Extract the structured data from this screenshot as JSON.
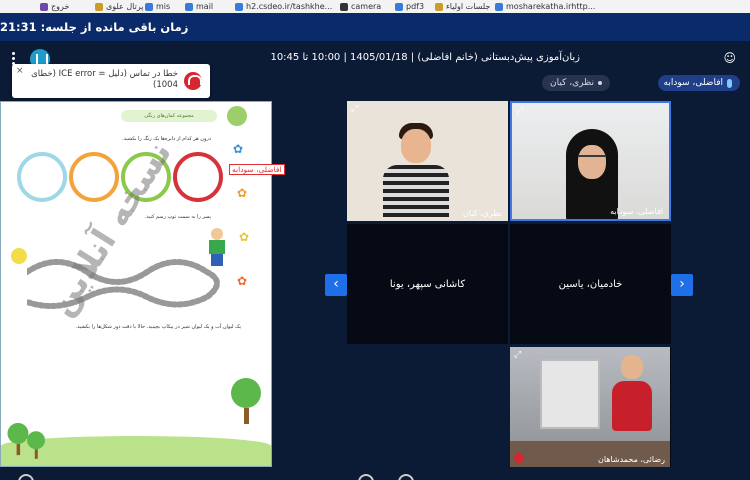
{
  "bookmarks": [
    "خروج",
    "پرتال علوی",
    "mis",
    "mail",
    "h2.csdeo.ir/tashkhe...",
    "camera",
    "pdf3",
    "جلسات اولیاء",
    "mosharekatha.irhttp..."
  ],
  "timer": {
    "label": "زمان باقی مانده از جلسه: 21:31"
  },
  "header": {
    "session_title": "زبان‌آموزی پیش‌دبستانی (خانم افاضلی) | 1405/01/18 | 10:00 تا 10:45"
  },
  "speakers": {
    "speaking": "افاضلی، سودابه",
    "other": "نظری، کیان"
  },
  "toast": {
    "text": "خطا در تماس (دلیل = ICE error (خطای 1004)",
    "close": "×"
  },
  "document": {
    "header": "مجموعه کمان‌های رنگی",
    "line1": "درون هر کدام از دایره‌ها یک رنگ را بکشید.",
    "line2": "پسر را به سمت توپ رسم کنید.",
    "line3": "یک لیوان آب و یک لیوان شیر در پیکاپ بچینید. حالا با دقت دور شکل‌ها را بکشید.",
    "annotation": "افاضلی، سودابه",
    "watermark": "نسخه آنلاین",
    "ring_colors": [
      "#9ed7e6",
      "#f2a43a",
      "#8cc84b",
      "#d6323a"
    ],
    "collapse": "−"
  },
  "videos": [
    {
      "name": "نظری، کیان"
    },
    {
      "name": "افاضلی، سودابه"
    },
    {
      "name": "کاشانی سپهر، یونا"
    },
    {
      "name": "خادمیان، یاسین"
    },
    {
      "name": "رضائی، محمدشاهان"
    }
  ],
  "nav": {
    "prev": "‹",
    "next": "›"
  },
  "icons": {
    "expand": "⤢",
    "kebab": "⋮",
    "user": "⛭"
  },
  "colors": {
    "background": "#0b1a35",
    "timer_bar": "#0a2a6a",
    "accent": "#1e6fe8",
    "error": "#d8262f"
  }
}
